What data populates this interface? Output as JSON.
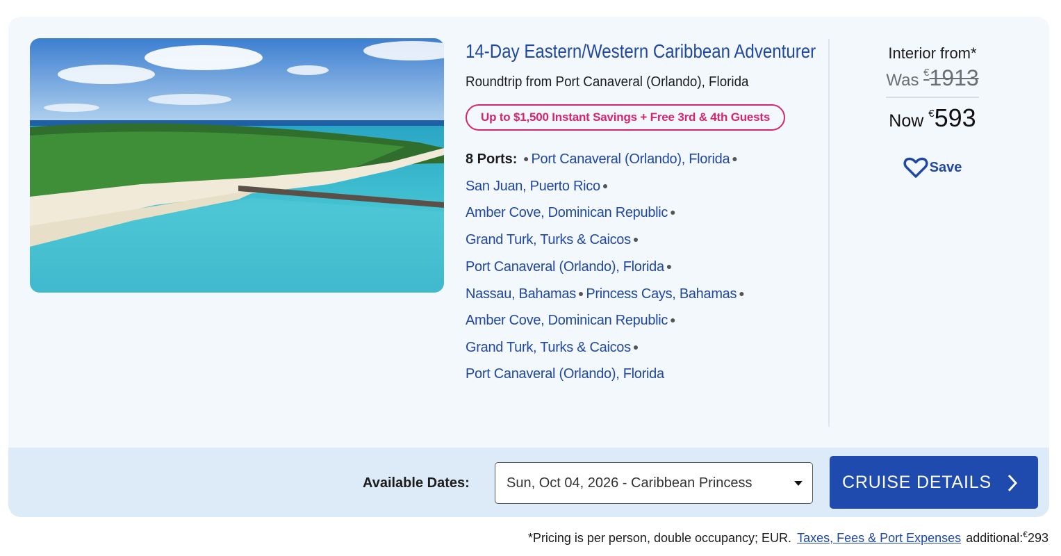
{
  "cruise": {
    "title": "14-Day Eastern/Western Caribbean Adventurer",
    "roundtrip": "Roundtrip from Port Canaveral (Orlando), Florida",
    "promo": "Up to $1,500 Instant Savings + Free 3rd & 4th Guests",
    "ports_label": "8 Ports:",
    "ports": [
      "Port Canaveral (Orlando), Florida",
      "San Juan, Puerto Rico",
      "Amber Cove, Dominican Republic",
      "Grand Turk, Turks & Caicos",
      "Port Canaveral (Orlando), Florida",
      "Nassau, Bahamas",
      "Princess Cays, Bahamas",
      "Amber Cove, Dominican Republic",
      "Grand Turk, Turks & Caicos",
      "Port Canaveral (Orlando), Florida"
    ]
  },
  "pricing": {
    "label": "Interior from*",
    "was_label": "Was",
    "currency": "€",
    "was_amount": "1913",
    "now_label": "Now",
    "now_amount": "593",
    "save_label": "Save"
  },
  "footer": {
    "available_dates_label": "Available Dates:",
    "selected_date": "Sun, Oct 04, 2026 - Caribbean Princess",
    "cta_label": "CRUISE DETAILS"
  },
  "disclaimer": {
    "text": "*Pricing is per person, double occupancy; EUR.",
    "link": "Taxes, Fees & Port Expenses",
    "suffix": "additional:",
    "currency": "€",
    "amount": "293"
  },
  "colors": {
    "brand_blue": "#1f47a3",
    "promo_pink": "#d6246e",
    "card_bg": "#f3f8fd",
    "band_bg": "#ddeaf7"
  }
}
